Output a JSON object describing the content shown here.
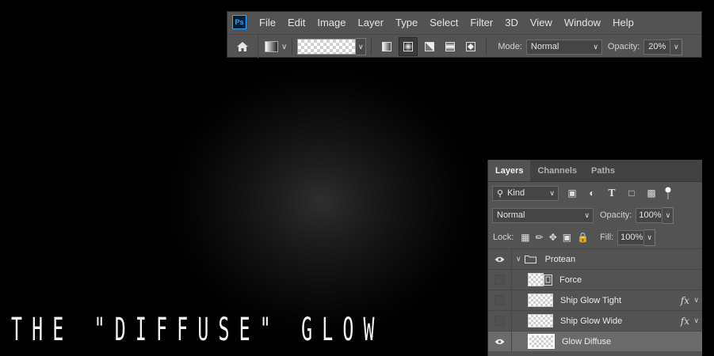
{
  "canvas": {
    "title": "THE \"DIFFUSE\" GLOW"
  },
  "menubar": {
    "logo": "Ps",
    "items": [
      "File",
      "Edit",
      "Image",
      "Layer",
      "Type",
      "Select",
      "Filter",
      "3D",
      "View",
      "Window",
      "Help"
    ]
  },
  "options": {
    "mode_label": "Mode:",
    "mode_value": "Normal",
    "opacity_label": "Opacity:",
    "opacity_value": "20%"
  },
  "layers_panel": {
    "tabs": [
      "Layers",
      "Channels",
      "Paths"
    ],
    "filter_kind": "Kind",
    "blend_mode": "Normal",
    "opacity_label": "Opacity:",
    "opacity_value": "100%",
    "lock_label": "Lock:",
    "fill_label": "Fill:",
    "fill_value": "100%",
    "layers": [
      {
        "name": "Protean",
        "visible": true,
        "type": "group"
      },
      {
        "name": "Force",
        "visible": false,
        "type": "layer"
      },
      {
        "name": "Ship Glow Tight",
        "visible": false,
        "type": "layer",
        "fx": "fx"
      },
      {
        "name": "Ship Glow Wide",
        "visible": false,
        "type": "layer",
        "fx": "fx"
      },
      {
        "name": "Glow Diffuse",
        "visible": true,
        "type": "layer",
        "selected": true
      }
    ]
  }
}
